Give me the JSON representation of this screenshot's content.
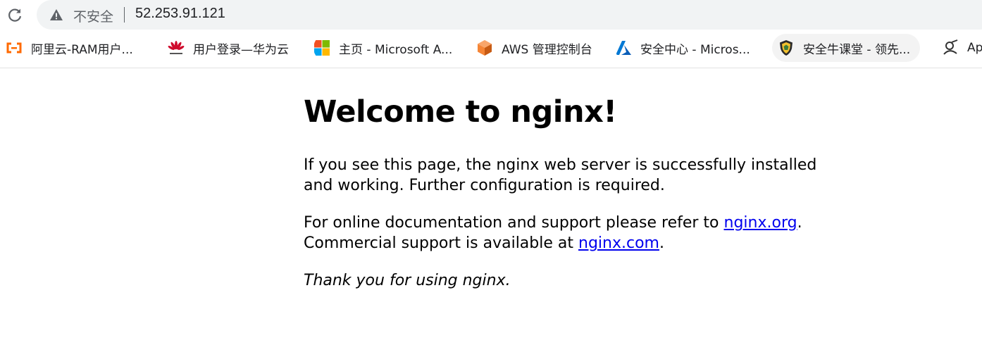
{
  "browser": {
    "security_label": "不安全",
    "url": "52.253.91.121",
    "bookmarks": [
      {
        "label": "阿里云-RAM用户...",
        "icon": "aliyun-icon"
      },
      {
        "label": "用户登录—华为云",
        "icon": "huawei-icon"
      },
      {
        "label": "主页 - Microsoft A...",
        "icon": "microsoft-icon"
      },
      {
        "label": "AWS 管理控制台",
        "icon": "aws-cube-icon"
      },
      {
        "label": "安全中心 - Micros...",
        "icon": "azure-icon"
      },
      {
        "label": "安全牛课堂 - 领先...",
        "icon": "shield-icon"
      },
      {
        "label": "Ap",
        "icon": "apps-icon"
      }
    ]
  },
  "page": {
    "title": "Welcome to nginx!",
    "para1": "If you see this page, the nginx web server is successfully installed and working. Further configuration is required.",
    "para2_prefix": "For online documentation and support please refer to ",
    "link_org": "nginx.org",
    "para2_mid": ".",
    "para2_line2": "Commercial support is available at ",
    "link_com": "nginx.com",
    "para2_suffix": ".",
    "thanks": "Thank you for using nginx."
  },
  "colors": {
    "link": "#0000ee",
    "omnibox_bg": "#f1f3f4",
    "aliyun": "#ff6a00",
    "huawei": "#cf0a2c",
    "aws": "#f58536",
    "azure": "#0078d4"
  }
}
